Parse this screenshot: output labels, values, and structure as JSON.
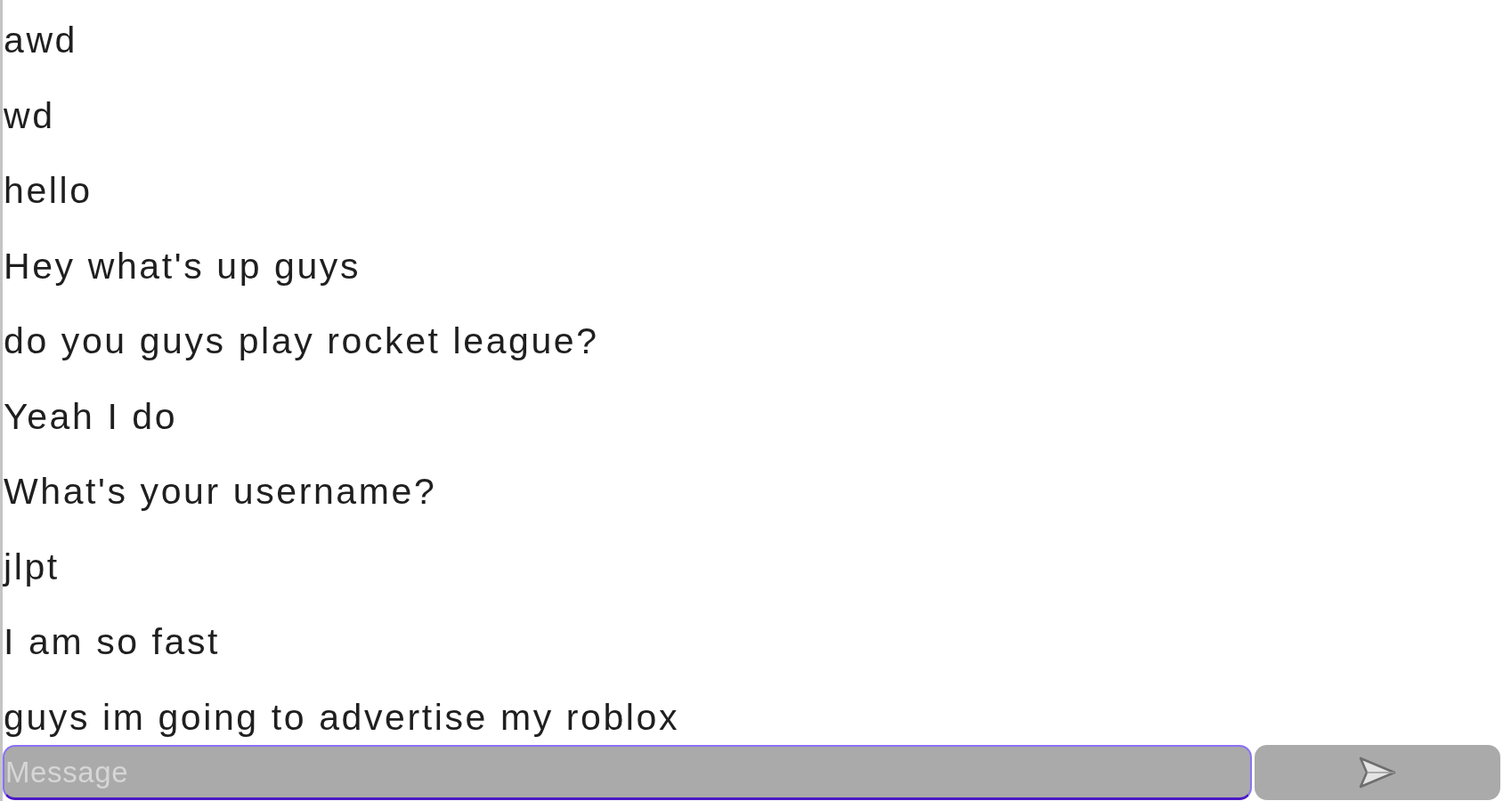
{
  "messages": [
    "awd",
    "wd",
    "hello",
    "Hey what's up guys",
    "do you guys play rocket league?",
    "Yeah I do",
    "What's your username?",
    "jlpt",
    "I am so fast",
    "guys im going to advertise my roblox"
  ],
  "composer": {
    "placeholder": "Message"
  }
}
